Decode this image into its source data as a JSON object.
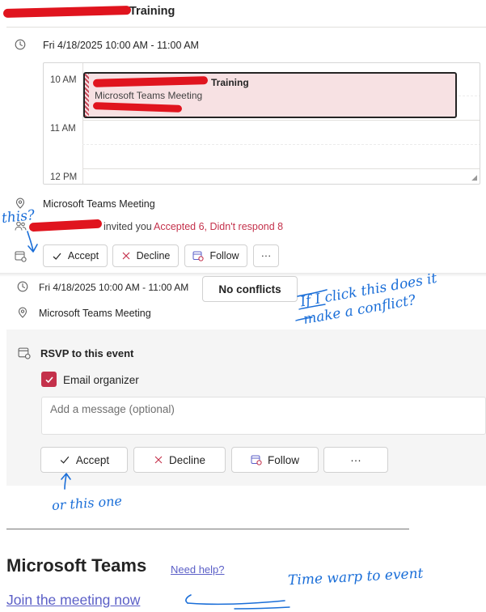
{
  "event": {
    "title": "Training",
    "datetime": "Fri 4/18/2025 10:00 AM - 11:00 AM",
    "location": "Microsoft Teams Meeting",
    "invited_suffix": "invited you",
    "response_summary": "Accepted 6, Didn't respond 8"
  },
  "calendar_preview": {
    "hours": [
      "10 AM",
      "11 AM",
      "12 PM"
    ],
    "event_title": "Training",
    "event_subtitle": "Microsoft Teams Meeting",
    "event_fill_color": "#f7e1e3",
    "event_stripe_color": "#c84b5b"
  },
  "top_actions": {
    "accept": "Accept",
    "decline": "Decline",
    "follow": "Follow",
    "more": "···"
  },
  "details": {
    "datetime": "Fri 4/18/2025 10:00 AM - 11:00 AM",
    "conflict_button": "No conflicts",
    "location": "Microsoft Teams Meeting"
  },
  "rsvp": {
    "title": "RSVP to this event",
    "email_organizer_label": "Email organizer",
    "email_organizer_checked": true,
    "message_placeholder": "Add a message (optional)",
    "accept": "Accept",
    "decline": "Decline",
    "follow": "Follow",
    "more": "···"
  },
  "teams_footer": {
    "title": "Microsoft Teams",
    "need_help": "Need help?",
    "join_link": "Join the meeting now"
  },
  "annotations": {
    "this": "this?",
    "conflict_question": "If I click this does it make a conflict?",
    "this_one": "or this one",
    "time_warp": "Time warp to event"
  },
  "colors": {
    "accent_red": "#c4314b",
    "link_purple": "#5b5fc7",
    "ink_blue": "#1a6ed8",
    "redaction_red": "#e0141e"
  },
  "icons": [
    "clock-icon",
    "location-icon",
    "people-icon",
    "calendar-rsvp-icon",
    "check-icon",
    "close-icon",
    "follow-icon",
    "more-icon",
    "checkbox-check-icon"
  ]
}
